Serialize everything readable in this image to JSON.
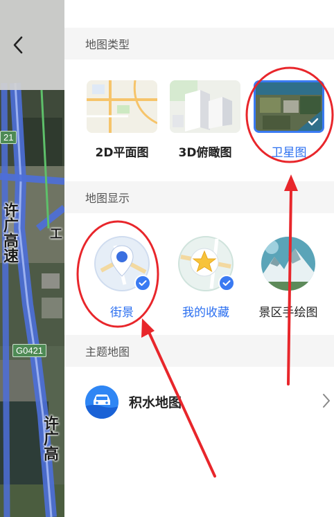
{
  "map": {
    "road_badge_top": "21",
    "road_badge_bottom": "G0421",
    "road_label_1": "许广高速",
    "road_label_2": "许广高",
    "road_label_side": "工"
  },
  "sections": {
    "map_type": {
      "title": "地图类型",
      "options": [
        {
          "label": "2D平面图",
          "icon": "2d-map-thumbnail",
          "selected": false
        },
        {
          "label": "3D俯瞰图",
          "icon": "3d-buildings-thumbnail",
          "selected": false
        },
        {
          "label": "卫星图",
          "icon": "satellite-thumbnail",
          "selected": true
        }
      ]
    },
    "map_display": {
      "title": "地图显示",
      "options": [
        {
          "label": "街景",
          "icon": "location-pin-icon",
          "selected": true
        },
        {
          "label": "我的收藏",
          "icon": "star-icon",
          "selected": true
        },
        {
          "label": "景区手绘图",
          "icon": "hand-drawn-scenic-icon",
          "selected": false
        }
      ]
    },
    "theme_map": {
      "title": "主题地图",
      "items": [
        {
          "label": "积水地图",
          "icon": "car-water-icon"
        }
      ]
    }
  },
  "colors": {
    "accent": "#2b6ff0",
    "badge": "#3a7af2",
    "annotation": "#e8262b",
    "section_bg": "#f5f5f5"
  }
}
